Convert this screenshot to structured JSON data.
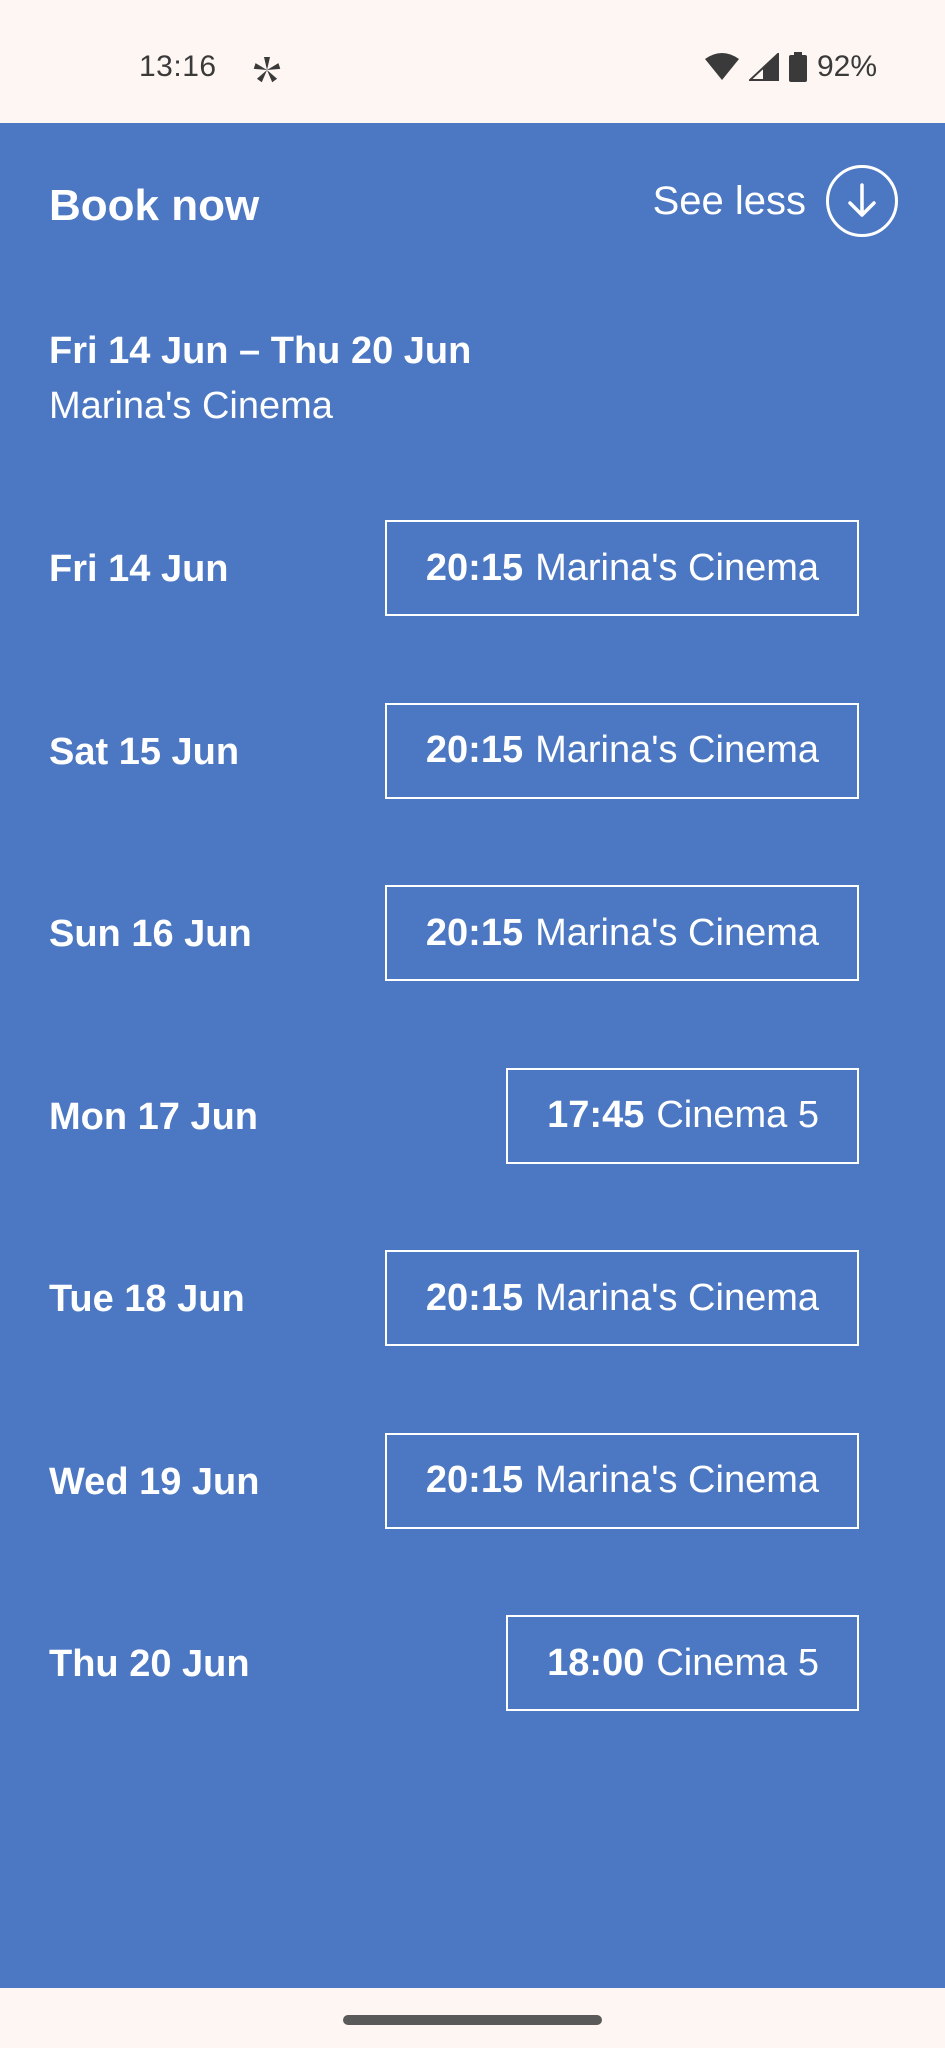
{
  "status_bar": {
    "time": "13:16",
    "app_icon": "pinwheel-icon",
    "battery_percent": "92%",
    "wifi_icon": "wifi-icon",
    "signal_icon": "cell-signal-icon",
    "battery_icon": "battery-icon"
  },
  "panel": {
    "title": "Book now",
    "toggle_label": "See less",
    "toggle_icon": "arrow-down-circle-icon",
    "date_range": "Fri 14 Jun – Thu 20 Jun",
    "venue": "Marina's Cinema",
    "background_color": "#4b77c3",
    "showings": [
      {
        "day": "Fri 14 Jun",
        "time": "20:15",
        "location": "Marina's Cinema"
      },
      {
        "day": "Sat 15 Jun",
        "time": "20:15",
        "location": "Marina's Cinema"
      },
      {
        "day": "Sun 16 Jun",
        "time": "20:15",
        "location": "Marina's Cinema"
      },
      {
        "day": "Mon 17 Jun",
        "time": "17:45",
        "location": "Cinema 5"
      },
      {
        "day": "Tue 18 Jun",
        "time": "20:15",
        "location": "Marina's Cinema"
      },
      {
        "day": "Wed 19 Jun",
        "time": "20:15",
        "location": "Marina's Cinema"
      },
      {
        "day": "Thu 20 Jun",
        "time": "18:00",
        "location": "Cinema 5"
      }
    ]
  }
}
